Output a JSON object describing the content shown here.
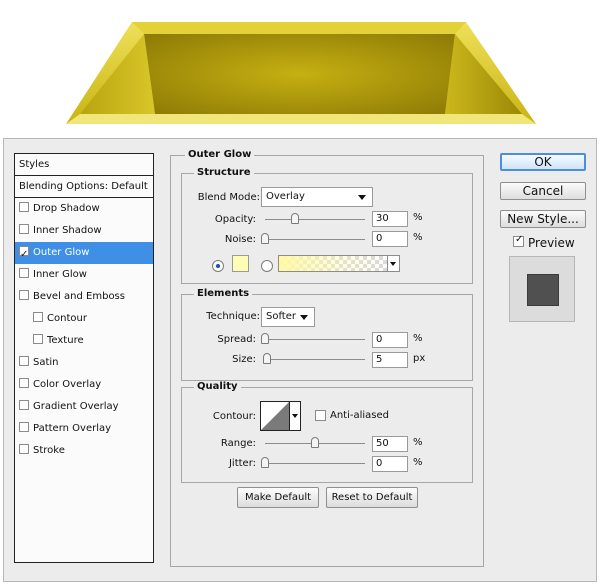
{
  "styles_panel": {
    "header": "Styles",
    "blending_options": "Blending Options: Default",
    "items": [
      {
        "label": "Drop Shadow",
        "checked": false,
        "indent": false,
        "selected": false
      },
      {
        "label": "Inner Shadow",
        "checked": false,
        "indent": false,
        "selected": false
      },
      {
        "label": "Outer Glow",
        "checked": true,
        "indent": false,
        "selected": true
      },
      {
        "label": "Inner Glow",
        "checked": false,
        "indent": false,
        "selected": false
      },
      {
        "label": "Bevel and Emboss",
        "checked": false,
        "indent": false,
        "selected": false
      },
      {
        "label": "Contour",
        "checked": false,
        "indent": true,
        "selected": false
      },
      {
        "label": "Texture",
        "checked": false,
        "indent": true,
        "selected": false
      },
      {
        "label": "Satin",
        "checked": false,
        "indent": false,
        "selected": false
      },
      {
        "label": "Color Overlay",
        "checked": false,
        "indent": false,
        "selected": false
      },
      {
        "label": "Gradient Overlay",
        "checked": false,
        "indent": false,
        "selected": false
      },
      {
        "label": "Pattern Overlay",
        "checked": false,
        "indent": false,
        "selected": false
      },
      {
        "label": "Stroke",
        "checked": false,
        "indent": false,
        "selected": false
      }
    ]
  },
  "outer_glow": {
    "title": "Outer Glow",
    "structure": {
      "title": "Structure",
      "blend_mode_label": "Blend Mode:",
      "blend_mode_value": "Overlay",
      "opacity_label": "Opacity:",
      "opacity_value": "30",
      "opacity_unit": "%",
      "opacity_fraction": 0.3,
      "noise_label": "Noise:",
      "noise_value": "0",
      "noise_unit": "%",
      "noise_fraction": 0.0,
      "glow_color": "#fffcb4",
      "gradient_start_color": "#fff9a6"
    },
    "elements": {
      "title": "Elements",
      "technique_label": "Technique:",
      "technique_value": "Softer",
      "spread_label": "Spread:",
      "spread_value": "0",
      "spread_unit": "%",
      "spread_fraction": 0.0,
      "size_label": "Size:",
      "size_value": "5",
      "size_unit": "px",
      "size_fraction": 0.02
    },
    "quality": {
      "title": "Quality",
      "contour_label": "Contour:",
      "anti_aliased_label": "Anti-aliased",
      "anti_aliased_checked": false,
      "range_label": "Range:",
      "range_value": "50",
      "range_unit": "%",
      "range_fraction": 0.5,
      "jitter_label": "Jitter:",
      "jitter_value": "0",
      "jitter_unit": "%",
      "jitter_fraction": 0.0
    },
    "make_default": "Make Default",
    "reset_to_default": "Reset to Default"
  },
  "actions": {
    "ok": "OK",
    "cancel": "Cancel",
    "new_style": "New Style...",
    "preview_label": "Preview",
    "preview_checked": true
  },
  "colors": {
    "gold": "#d8c51c",
    "selection_blue": "#3f8fe6",
    "preview_swatch": "#505050"
  }
}
